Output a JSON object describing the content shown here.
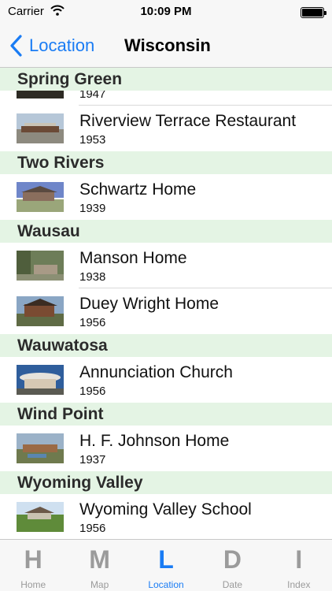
{
  "status_bar": {
    "carrier": "Carrier",
    "time": "10:09 PM"
  },
  "nav": {
    "back_label": "Location",
    "title": "Wisconsin"
  },
  "list": {
    "spring_green": {
      "header": "Spring Green",
      "partial_year": "1947",
      "title": "Riverview Terrace Restaurant",
      "year": "1953"
    },
    "two_rivers": {
      "header": "Two Rivers",
      "title": "Schwartz Home",
      "year": "1939"
    },
    "wausau": {
      "header": "Wausau",
      "items": [
        {
          "title": "Manson Home",
          "year": "1938"
        },
        {
          "title": "Duey Wright Home",
          "year": "1956"
        }
      ]
    },
    "wauwatosa": {
      "header": "Wauwatosa",
      "title": "Annunciation Church",
      "year": "1956"
    },
    "wind_point": {
      "header": "Wind Point",
      "title": "H. F. Johnson Home",
      "year": "1937"
    },
    "wyoming_valley": {
      "header": "Wyoming Valley",
      "title": "Wyoming Valley School",
      "year": "1956"
    }
  },
  "tabs": [
    {
      "letter": "H",
      "label": "Home"
    },
    {
      "letter": "M",
      "label": "Map"
    },
    {
      "letter": "L",
      "label": "Location"
    },
    {
      "letter": "D",
      "label": "Date"
    },
    {
      "letter": "I",
      "label": "Index"
    }
  ],
  "colors": {
    "accent": "#1a7cf4",
    "section_bg": "#e4f4e4",
    "tab_inactive": "#9b9b9b"
  }
}
